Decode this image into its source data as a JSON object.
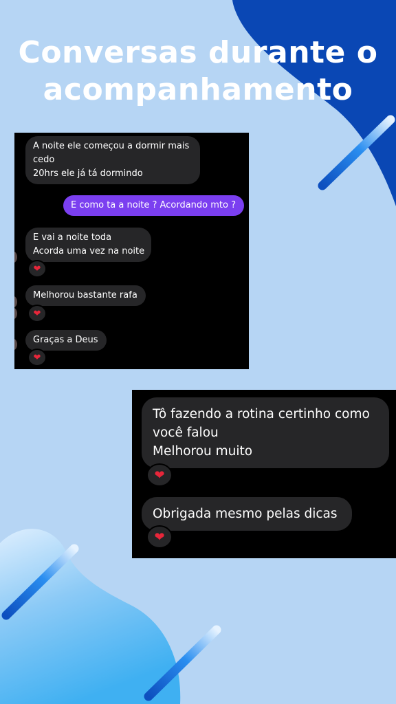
{
  "title": {
    "line1": "Conversas durante o",
    "line2": "acompanhamento"
  },
  "chat1": {
    "messages": [
      {
        "direction": "received",
        "lines": [
          "A noite ele começou a dormir mais",
          "cedo",
          "20hrs ele já tá dormindo"
        ]
      },
      {
        "direction": "sent",
        "lines": [
          "E como ta a noite ? Acordando mto ?"
        ]
      },
      {
        "direction": "received",
        "lines": [
          "E vai a noite toda",
          "Acorda uma vez na noite"
        ],
        "reaction": "heart"
      },
      {
        "direction": "received",
        "lines": [
          "Melhorou bastante rafa"
        ],
        "reaction": "heart"
      },
      {
        "direction": "received",
        "lines": [
          "Graças a Deus"
        ],
        "reaction": "heart"
      }
    ]
  },
  "chat2": {
    "messages": [
      {
        "direction": "received",
        "lines": [
          "Tô fazendo a rotina certinho como",
          "você falou",
          "Melhorou muito"
        ],
        "reaction": "heart"
      },
      {
        "direction": "received",
        "lines": [
          "Obrigada mesmo pelas dicas"
        ],
        "reaction": "heart"
      }
    ]
  },
  "colors": {
    "background": "#b6d5f4",
    "accent_dark_blue": "#0a47b4",
    "sent_bubble": "#7b3ff0",
    "received_bubble": "#262628",
    "heart": "#e8263a"
  },
  "icons": {
    "reaction": "heart-icon"
  }
}
